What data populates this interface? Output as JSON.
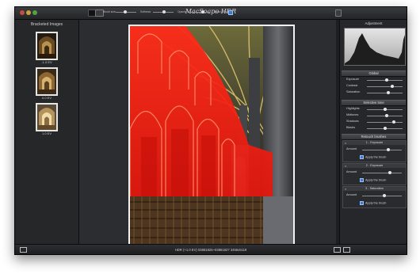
{
  "window": {
    "title": "MacSoapo HDR"
  },
  "toolbar": {
    "brush_size_label": "Brush size",
    "softness_label": "Softness",
    "opacity_label": "Opacity",
    "show_mask_label": "Show Mask",
    "brush_size": 0.45,
    "softness": 0.55,
    "opacity": 0.7
  },
  "left_panel": {
    "title": "Bracketed Images",
    "thumbs": [
      {
        "label": "-1.0 EV"
      },
      {
        "label": "0.0 EV"
      },
      {
        "label": "1.0 EV"
      }
    ]
  },
  "right_panel": {
    "adjustment_title": "Adjustment",
    "global": {
      "title": "Global",
      "rows": [
        {
          "label": "Exposure",
          "value": 0.55
        },
        {
          "label": "Contrast",
          "value": 0.7
        },
        {
          "label": "Saturation",
          "value": 0.6
        }
      ]
    },
    "selective": {
      "title": "Selective tone",
      "rows": [
        {
          "label": "Highlights",
          "value": 0.5
        },
        {
          "label": "Midtones",
          "value": 0.55
        },
        {
          "label": "Shadows",
          "value": 0.75
        },
        {
          "label": "Blacks",
          "value": 0.5
        }
      ]
    },
    "retouch": {
      "title": "Retouch brushes",
      "brushes": [
        {
          "name": "1 - Exposure",
          "amount_label": "Amount",
          "amount": 0.65,
          "apply_label": "Apply the brush"
        },
        {
          "name": "2 - Exposure",
          "amount_label": "Amount",
          "amount": 0.7,
          "apply_label": "Apply the brush"
        },
        {
          "name": "3 - Saturation",
          "amount_label": "Amount",
          "amount": 0.55,
          "apply_label": "Apply the brush"
        }
      ]
    }
  },
  "status": {
    "text": "HDR (+1.0 EV) 03881825~03881827 3456x5119"
  },
  "colors": {
    "mask": "#ff1a10",
    "accent": "#3c79d8"
  }
}
